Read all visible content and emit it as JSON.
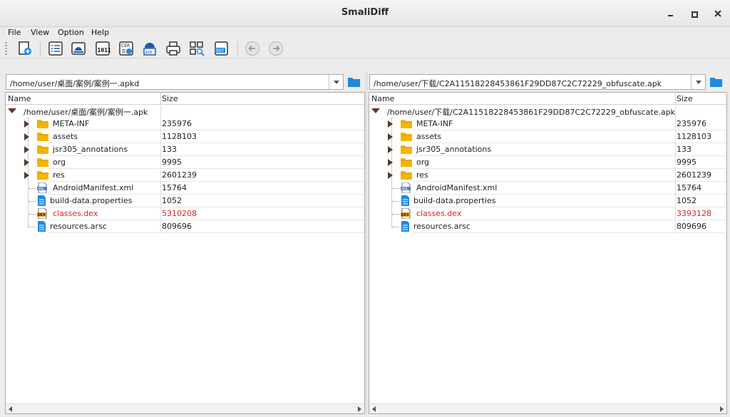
{
  "window": {
    "title": "SmaliDiff"
  },
  "menu": [
    "File",
    "View",
    "Option",
    "Help"
  ],
  "toolbar": {
    "buttons": [
      "new-compare-icon",
      "list-icon",
      "android-icon",
      "binary-icon",
      "certificate-icon",
      "android-resources-icon",
      "print-icon",
      "find-icon",
      "ref-icon"
    ],
    "nav": [
      "back-icon",
      "forward-icon"
    ]
  },
  "columns": {
    "name": "Name",
    "size": "Size"
  },
  "left": {
    "path": "/home/user/桌面/案例/案例一.apkd",
    "root": "/home/user/桌面/案例/案例一.apk",
    "rows": [
      {
        "name": "META-INF",
        "size": "235976",
        "type": "folder"
      },
      {
        "name": "assets",
        "size": "1128103",
        "type": "folder"
      },
      {
        "name": "jsr305_annotations",
        "size": "133",
        "type": "folder"
      },
      {
        "name": "org",
        "size": "9995",
        "type": "folder"
      },
      {
        "name": "res",
        "size": "2601239",
        "type": "folder"
      },
      {
        "name": "AndroidManifest.xml",
        "size": "15764",
        "type": "xml"
      },
      {
        "name": "build-data.properties",
        "size": "1052",
        "type": "doc"
      },
      {
        "name": "classes.dex",
        "size": "5310208",
        "type": "dex",
        "changed": true
      },
      {
        "name": "resources.arsc",
        "size": "809696",
        "type": "doc"
      }
    ]
  },
  "right": {
    "path": "/home/user/下载/C2A11518228453861F29DD87C2C72229_obfuscate.apk",
    "root": "/home/user/下载/C2A11518228453861F29DD87C2C72229_obfuscate.apk",
    "rows": [
      {
        "name": "META-INF",
        "size": "235976",
        "type": "folder"
      },
      {
        "name": "assets",
        "size": "1128103",
        "type": "folder"
      },
      {
        "name": "jsr305_annotations",
        "size": "133",
        "type": "folder"
      },
      {
        "name": "org",
        "size": "9995",
        "type": "folder"
      },
      {
        "name": "res",
        "size": "2601239",
        "type": "folder"
      },
      {
        "name": "AndroidManifest.xml",
        "size": "15764",
        "type": "xml"
      },
      {
        "name": "build-data.properties",
        "size": "1052",
        "type": "doc"
      },
      {
        "name": "classes.dex",
        "size": "3393128",
        "type": "dex",
        "changed": true
      },
      {
        "name": "resources.arsc",
        "size": "809696",
        "type": "doc"
      }
    ]
  },
  "colors": {
    "changed": "#e02020",
    "folder": "#f5b400",
    "accent": "#1f8ae0"
  }
}
